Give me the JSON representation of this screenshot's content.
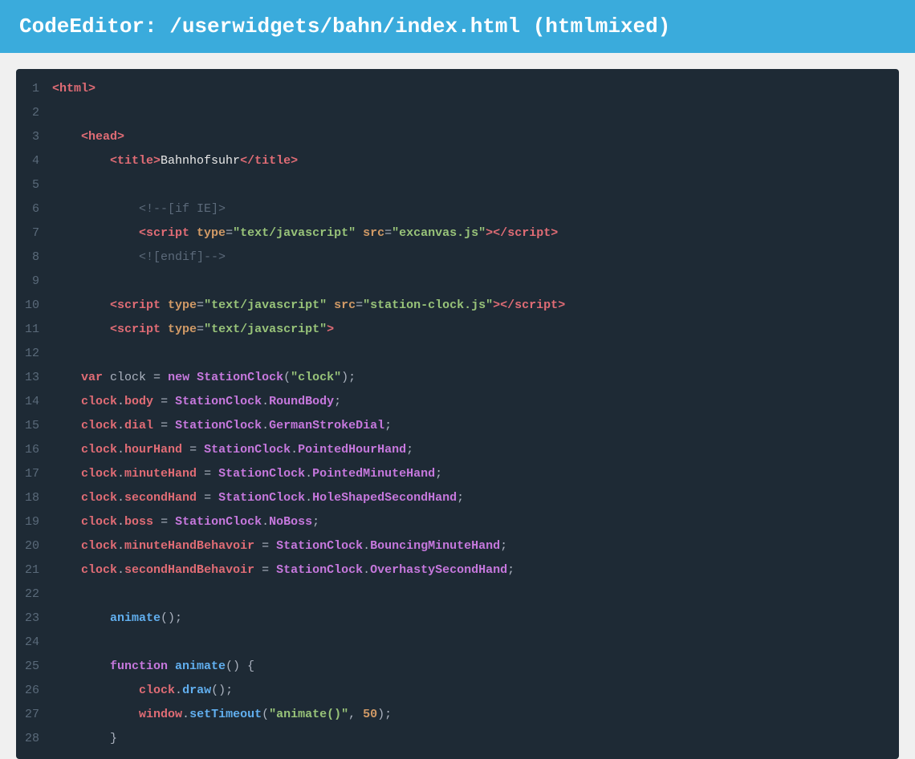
{
  "header": {
    "title": "CodeEditor:  /userwidgets/bahn/index.html (htmlmixed)",
    "bg_color": "#3aabdc"
  },
  "editor": {
    "bg_color": "#1e2a35",
    "lines": [
      {
        "num": 1,
        "tokens": [
          {
            "text": "<html>",
            "cls": "bold-tag"
          }
        ]
      },
      {
        "num": 2,
        "tokens": []
      },
      {
        "num": 3,
        "tokens": [
          {
            "text": "    ",
            "cls": "plain"
          },
          {
            "text": "<head>",
            "cls": "bold-tag"
          }
        ]
      },
      {
        "num": 4,
        "tokens": [
          {
            "text": "        ",
            "cls": "plain"
          },
          {
            "text": "<title>",
            "cls": "bold-tag"
          },
          {
            "text": "Bahnhofsuhr",
            "cls": "text-white"
          },
          {
            "text": "</title>",
            "cls": "bold-tag"
          }
        ]
      },
      {
        "num": 5,
        "tokens": []
      },
      {
        "num": 6,
        "tokens": [
          {
            "text": "            ",
            "cls": "plain"
          },
          {
            "text": "<!--[if IE]>",
            "cls": "comment"
          }
        ]
      },
      {
        "num": 7,
        "tokens": [
          {
            "text": "            ",
            "cls": "plain"
          },
          {
            "text": "<script ",
            "cls": "bold-tag"
          },
          {
            "text": "type",
            "cls": "bold-attr"
          },
          {
            "text": "=",
            "cls": "plain"
          },
          {
            "text": "\"text/javascript\"",
            "cls": "bold-val"
          },
          {
            "text": " src",
            "cls": "bold-attr"
          },
          {
            "text": "=",
            "cls": "plain"
          },
          {
            "text": "\"excanvas.js\"",
            "cls": "bold-val"
          },
          {
            "text": "></",
            "cls": "bold-tag"
          },
          {
            "text": "script",
            "cls": "bold-tag"
          },
          {
            "text": ">",
            "cls": "bold-tag"
          }
        ]
      },
      {
        "num": 8,
        "tokens": [
          {
            "text": "            ",
            "cls": "plain"
          },
          {
            "text": "<![endif]-->",
            "cls": "comment"
          }
        ]
      },
      {
        "num": 9,
        "tokens": []
      },
      {
        "num": 10,
        "tokens": [
          {
            "text": "        ",
            "cls": "plain"
          },
          {
            "text": "<script ",
            "cls": "bold-tag"
          },
          {
            "text": "type",
            "cls": "bold-attr"
          },
          {
            "text": "=",
            "cls": "plain"
          },
          {
            "text": "\"text/javascript\"",
            "cls": "bold-val"
          },
          {
            "text": " src",
            "cls": "bold-attr"
          },
          {
            "text": "=",
            "cls": "plain"
          },
          {
            "text": "\"station-clock.js\"",
            "cls": "bold-val"
          },
          {
            "text": "></",
            "cls": "bold-tag"
          },
          {
            "text": "script",
            "cls": "bold-tag"
          },
          {
            "text": ">",
            "cls": "bold-tag"
          }
        ]
      },
      {
        "num": 11,
        "tokens": [
          {
            "text": "        ",
            "cls": "plain"
          },
          {
            "text": "<script ",
            "cls": "bold-tag"
          },
          {
            "text": "type",
            "cls": "bold-attr"
          },
          {
            "text": "=",
            "cls": "plain"
          },
          {
            "text": "\"text/javascript\"",
            "cls": "bold-val"
          },
          {
            "text": ">",
            "cls": "bold-tag"
          }
        ]
      },
      {
        "num": 12,
        "tokens": []
      },
      {
        "num": 13,
        "tokens": [
          {
            "text": "    ",
            "cls": "plain"
          },
          {
            "text": "var ",
            "cls": "bold-prop"
          },
          {
            "text": "clock",
            "cls": "plain"
          },
          {
            "text": " = ",
            "cls": "plain"
          },
          {
            "text": "new ",
            "cls": "bold-class"
          },
          {
            "text": "StationClock",
            "cls": "bold-class"
          },
          {
            "text": "(",
            "cls": "plain"
          },
          {
            "text": "\"clock\"",
            "cls": "bold-str"
          },
          {
            "text": ");",
            "cls": "plain"
          }
        ]
      },
      {
        "num": 14,
        "tokens": [
          {
            "text": "    ",
            "cls": "plain"
          },
          {
            "text": "clock",
            "cls": "bold-prop"
          },
          {
            "text": ".",
            "cls": "plain"
          },
          {
            "text": "body",
            "cls": "bold-prop"
          },
          {
            "text": " = ",
            "cls": "plain"
          },
          {
            "text": "StationClock",
            "cls": "bold-class"
          },
          {
            "text": ".",
            "cls": "plain"
          },
          {
            "text": "RoundBody",
            "cls": "bold-class"
          },
          {
            "text": ";",
            "cls": "plain"
          }
        ]
      },
      {
        "num": 15,
        "tokens": [
          {
            "text": "    ",
            "cls": "plain"
          },
          {
            "text": "clock",
            "cls": "bold-prop"
          },
          {
            "text": ".",
            "cls": "plain"
          },
          {
            "text": "dial",
            "cls": "bold-prop"
          },
          {
            "text": " = ",
            "cls": "plain"
          },
          {
            "text": "StationClock",
            "cls": "bold-class"
          },
          {
            "text": ".",
            "cls": "plain"
          },
          {
            "text": "GermanStrokeDial",
            "cls": "bold-class"
          },
          {
            "text": ";",
            "cls": "plain"
          }
        ]
      },
      {
        "num": 16,
        "tokens": [
          {
            "text": "    ",
            "cls": "plain"
          },
          {
            "text": "clock",
            "cls": "bold-prop"
          },
          {
            "text": ".",
            "cls": "plain"
          },
          {
            "text": "hourHand",
            "cls": "bold-prop"
          },
          {
            "text": " = ",
            "cls": "plain"
          },
          {
            "text": "StationClock",
            "cls": "bold-class"
          },
          {
            "text": ".",
            "cls": "plain"
          },
          {
            "text": "PointedHourHand",
            "cls": "bold-class"
          },
          {
            "text": ";",
            "cls": "plain"
          }
        ]
      },
      {
        "num": 17,
        "tokens": [
          {
            "text": "    ",
            "cls": "plain"
          },
          {
            "text": "clock",
            "cls": "bold-prop"
          },
          {
            "text": ".",
            "cls": "plain"
          },
          {
            "text": "minuteHand",
            "cls": "bold-prop"
          },
          {
            "text": " = ",
            "cls": "plain"
          },
          {
            "text": "StationClock",
            "cls": "bold-class"
          },
          {
            "text": ".",
            "cls": "plain"
          },
          {
            "text": "PointedMinuteHand",
            "cls": "bold-class"
          },
          {
            "text": ";",
            "cls": "plain"
          }
        ]
      },
      {
        "num": 18,
        "tokens": [
          {
            "text": "    ",
            "cls": "plain"
          },
          {
            "text": "clock",
            "cls": "bold-prop"
          },
          {
            "text": ".",
            "cls": "plain"
          },
          {
            "text": "secondHand",
            "cls": "bold-prop"
          },
          {
            "text": " = ",
            "cls": "plain"
          },
          {
            "text": "StationClock",
            "cls": "bold-class"
          },
          {
            "text": ".",
            "cls": "plain"
          },
          {
            "text": "HoleShapedSecondHand",
            "cls": "bold-class"
          },
          {
            "text": ";",
            "cls": "plain"
          }
        ]
      },
      {
        "num": 19,
        "tokens": [
          {
            "text": "    ",
            "cls": "plain"
          },
          {
            "text": "clock",
            "cls": "bold-prop"
          },
          {
            "text": ".",
            "cls": "plain"
          },
          {
            "text": "boss",
            "cls": "bold-prop"
          },
          {
            "text": " = ",
            "cls": "plain"
          },
          {
            "text": "StationClock",
            "cls": "bold-class"
          },
          {
            "text": ".",
            "cls": "plain"
          },
          {
            "text": "NoBoss",
            "cls": "bold-class"
          },
          {
            "text": ";",
            "cls": "plain"
          }
        ]
      },
      {
        "num": 20,
        "tokens": [
          {
            "text": "    ",
            "cls": "plain"
          },
          {
            "text": "clock",
            "cls": "bold-prop"
          },
          {
            "text": ".",
            "cls": "plain"
          },
          {
            "text": "minuteHandBehavoir",
            "cls": "bold-prop"
          },
          {
            "text": " = ",
            "cls": "plain"
          },
          {
            "text": "StationClock",
            "cls": "bold-class"
          },
          {
            "text": ".",
            "cls": "plain"
          },
          {
            "text": "BouncingMinuteHand",
            "cls": "bold-class"
          },
          {
            "text": ";",
            "cls": "plain"
          }
        ]
      },
      {
        "num": 21,
        "tokens": [
          {
            "text": "    ",
            "cls": "plain"
          },
          {
            "text": "clock",
            "cls": "bold-prop"
          },
          {
            "text": ".",
            "cls": "plain"
          },
          {
            "text": "secondHandBehavoir",
            "cls": "bold-prop"
          },
          {
            "text": " = ",
            "cls": "plain"
          },
          {
            "text": "StationClock",
            "cls": "bold-class"
          },
          {
            "text": ".",
            "cls": "plain"
          },
          {
            "text": "OverhastySecondHand",
            "cls": "bold-class"
          },
          {
            "text": ";",
            "cls": "plain"
          }
        ]
      },
      {
        "num": 22,
        "tokens": []
      },
      {
        "num": 23,
        "tokens": [
          {
            "text": "        ",
            "cls": "plain"
          },
          {
            "text": "animate",
            "cls": "bold-func"
          },
          {
            "text": "();",
            "cls": "plain"
          }
        ]
      },
      {
        "num": 24,
        "tokens": []
      },
      {
        "num": 25,
        "tokens": [
          {
            "text": "        ",
            "cls": "plain"
          },
          {
            "text": "function ",
            "cls": "bold-kw"
          },
          {
            "text": "animate",
            "cls": "bold-func"
          },
          {
            "text": "() {",
            "cls": "plain"
          }
        ]
      },
      {
        "num": 26,
        "tokens": [
          {
            "text": "            ",
            "cls": "plain"
          },
          {
            "text": "clock",
            "cls": "bold-prop"
          },
          {
            "text": ".",
            "cls": "plain"
          },
          {
            "text": "draw",
            "cls": "bold-func"
          },
          {
            "text": "();",
            "cls": "plain"
          }
        ]
      },
      {
        "num": 27,
        "tokens": [
          {
            "text": "            ",
            "cls": "plain"
          },
          {
            "text": "window",
            "cls": "bold-prop"
          },
          {
            "text": ".",
            "cls": "plain"
          },
          {
            "text": "setTimeout",
            "cls": "bold-func"
          },
          {
            "text": "(",
            "cls": "plain"
          },
          {
            "text": "\"animate()\"",
            "cls": "bold-str"
          },
          {
            "text": ", ",
            "cls": "plain"
          },
          {
            "text": "50",
            "cls": "bold-num"
          },
          {
            "text": ");",
            "cls": "plain"
          }
        ]
      },
      {
        "num": 28,
        "tokens": [
          {
            "text": "        ",
            "cls": "plain"
          },
          {
            "text": "}",
            "cls": "plain"
          }
        ]
      }
    ]
  }
}
